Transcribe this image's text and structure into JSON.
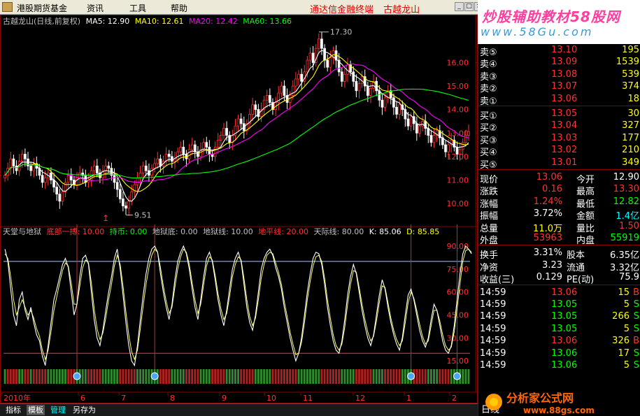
{
  "menu": {
    "items": [
      "港股期货基金",
      "资讯",
      "工具",
      "帮助"
    ],
    "center_title": "通达信金融终端",
    "stock_link": "古越龙山",
    "win_buttons": [
      "_",
      "□",
      "×"
    ]
  },
  "banner": {
    "title": "炒股辅助教材58股网",
    "url": "www.58Gu.com"
  },
  "main_chart": {
    "header": {
      "name": "古越龙山(日线,前复权)",
      "ma5": "MA5: 12.90",
      "ma10": "MA10: 12.61",
      "ma20": "MA20: 12.42",
      "ma60": "MA60: 13.66"
    },
    "high_label": "17.30",
    "low_label": "9.51",
    "y_ticks": [
      "16.00",
      "15.00",
      "14.00",
      "13.00",
      "12.00",
      "11.00",
      "10.00"
    ],
    "y_tick_values": [
      16,
      15,
      14,
      13,
      12,
      11,
      10
    ],
    "ylim": [
      9.2,
      17.5
    ],
    "colors": {
      "up": "#ff3232",
      "down": "#ffffff",
      "ma5": "#ffffff",
      "ma10": "#ffff00",
      "ma20": "#ff00ff",
      "ma60": "#00ff00"
    }
  },
  "indicator": {
    "header": {
      "name": "天堂与地狱",
      "bottom_buy": "底部一搏: 10.00",
      "hold": "持币: 0.00",
      "hell_bottom": "地狱底: 0.00",
      "hell_line": "地狱线: 10.00",
      "flat_line": "地平线: 20.00",
      "sky_line": "天际线: 80.00",
      "k": "K: 85.06",
      "d": "D: 85.85"
    },
    "y_ticks": [
      "90.00",
      "75.00",
      "60.00",
      "45.00",
      "30.00",
      "15.00"
    ],
    "y_tick_values": [
      90,
      75,
      60,
      45,
      30,
      15
    ],
    "ylim": [
      0,
      95
    ],
    "sky": 80,
    "flat": 20
  },
  "x_axis": {
    "labels": [
      "2010年",
      "6",
      "7",
      "8",
      "9",
      "10",
      "11",
      "12",
      "1",
      "2"
    ]
  },
  "chart_data": {
    "type": "candlestick",
    "note_series": "price panel daily OHLC; indicator panel K and D lines",
    "candles_close": [
      11.2,
      11.5,
      11.9,
      11.6,
      11.4,
      11.8,
      12.1,
      11.9,
      11.6,
      11.4,
      11.7,
      11.5,
      11.2,
      10.9,
      11.1,
      11.3,
      11.0,
      10.7,
      10.4,
      10.1,
      10.5,
      10.9,
      11.2,
      11.0,
      10.8,
      11.1,
      11.3,
      11.2,
      10.9,
      11.0,
      11.4,
      11.6,
      11.3,
      11.1,
      11.4,
      11.6,
      11.5,
      11.2,
      10.9,
      10.6,
      10.2,
      9.9,
      9.8,
      10.1,
      10.5,
      10.8,
      11.1,
      11.3,
      11.6,
      11.4,
      11.2,
      11.5,
      11.7,
      11.9,
      11.6,
      11.8,
      12.1,
      12.0,
      11.8,
      11.9,
      12.2,
      12.4,
      12.1,
      11.9,
      12.3,
      12.5,
      12.2,
      12.0,
      12.3,
      12.6,
      12.4,
      12.1,
      12.0,
      12.4,
      12.7,
      12.9,
      13.2,
      12.9,
      12.6,
      12.9,
      13.3,
      13.6,
      13.4,
      13.1,
      13.4,
      13.8,
      14.2,
      14.0,
      13.7,
      14.0,
      14.4,
      14.6,
      14.3,
      14.0,
      14.3,
      14.7,
      15.0,
      14.6,
      14.3,
      14.6,
      15.0,
      15.3,
      15.5,
      15.2,
      15.6,
      16.1,
      16.4,
      16.0,
      16.6,
      17.0,
      16.6,
      16.1,
      15.8,
      16.2,
      16.5,
      16.1,
      15.6,
      15.2,
      15.5,
      15.9,
      15.6,
      15.2,
      14.8,
      15.1,
      15.4,
      15.0,
      14.6,
      14.9,
      15.2,
      14.8,
      14.4,
      14.1,
      14.5,
      14.8,
      14.5,
      14.1,
      13.8,
      14.2,
      14.0,
      13.6,
      13.3,
      13.7,
      13.4,
      13.0,
      13.3,
      13.5,
      13.2,
      12.9,
      12.6,
      12.9,
      13.1,
      12.8,
      12.5,
      12.2,
      12.5,
      12.7,
      12.4,
      12.1,
      12.3,
      12.6,
      12.9,
      13.06
    ],
    "k_values": [
      88,
      80,
      62,
      45,
      38,
      55,
      60,
      48,
      42,
      50,
      40,
      32,
      28,
      18,
      12,
      25,
      40,
      55,
      62,
      70,
      78,
      82,
      76,
      60,
      45,
      52,
      70,
      82,
      84,
      78,
      60,
      42,
      30,
      25,
      35,
      48,
      60,
      70,
      82,
      88,
      75,
      58,
      40,
      25,
      15,
      12,
      25,
      42,
      58,
      72,
      82,
      88,
      90,
      86,
      72,
      60,
      50,
      42,
      52,
      68,
      80,
      86,
      90,
      85,
      75,
      62,
      50,
      42,
      55,
      70,
      82,
      86,
      80,
      68,
      55,
      45,
      38,
      48,
      62,
      75,
      82,
      86,
      80,
      65,
      50,
      40,
      35,
      45,
      60,
      75,
      82,
      86,
      88,
      84,
      76,
      70,
      62,
      50,
      40,
      30,
      22,
      15,
      20,
      30,
      45,
      60,
      72,
      82,
      86,
      85,
      78,
      65,
      50,
      38,
      28,
      22,
      20,
      28,
      42,
      58,
      70,
      78,
      72,
      60,
      48,
      38,
      30,
      25,
      32,
      45,
      58,
      68,
      62,
      50,
      40,
      32,
      26,
      22,
      30,
      45,
      58,
      62,
      55,
      45,
      35,
      28,
      24,
      30,
      42,
      52,
      48,
      38,
      28,
      22,
      20,
      25,
      38,
      55,
      72,
      85,
      90,
      88,
      85.06
    ],
    "d_values": [
      85,
      82,
      70,
      55,
      45,
      50,
      55,
      50,
      45,
      48,
      43,
      36,
      31,
      22,
      16,
      22,
      34,
      48,
      57,
      66,
      74,
      79,
      77,
      66,
      52,
      52,
      64,
      76,
      81,
      79,
      66,
      49,
      36,
      29,
      33,
      43,
      55,
      65,
      77,
      84,
      78,
      64,
      47,
      32,
      21,
      16,
      22,
      36,
      51,
      65,
      76,
      84,
      88,
      86,
      76,
      64,
      54,
      46,
      50,
      63,
      75,
      83,
      88,
      86,
      78,
      66,
      55,
      46,
      52,
      65,
      77,
      83,
      81,
      71,
      59,
      49,
      42,
      46,
      57,
      70,
      78,
      83,
      81,
      69,
      55,
      44,
      38,
      43,
      55,
      69,
      78,
      84,
      86,
      85,
      79,
      73,
      65,
      54,
      44,
      34,
      26,
      19,
      20,
      27,
      40,
      55,
      67,
      77,
      83,
      84,
      80,
      69,
      55,
      43,
      32,
      25,
      22,
      26,
      37,
      52,
      65,
      74,
      73,
      63,
      52,
      42,
      34,
      28,
      31,
      41,
      53,
      64,
      63,
      53,
      43,
      35,
      29,
      25,
      28,
      40,
      53,
      60,
      56,
      48,
      39,
      31,
      26,
      28,
      38,
      48,
      48,
      41,
      32,
      25,
      22,
      24,
      34,
      49,
      65,
      80,
      87,
      88,
      85.85
    ],
    "buy_marker_indices": [
      25,
      52,
      141,
      157,
      171,
      183
    ]
  },
  "quotes": {
    "asks": [
      {
        "label": "卖⑤",
        "price": "13.10",
        "vol": "195"
      },
      {
        "label": "卖④",
        "price": "13.09",
        "vol": "1539"
      },
      {
        "label": "卖③",
        "price": "13.08",
        "vol": "539"
      },
      {
        "label": "卖②",
        "price": "13.07",
        "vol": "374"
      },
      {
        "label": "卖①",
        "price": "13.06",
        "vol": "18"
      }
    ],
    "bids": [
      {
        "label": "买①",
        "price": "13.05",
        "vol": "30"
      },
      {
        "label": "买②",
        "price": "13.04",
        "vol": "327"
      },
      {
        "label": "买③",
        "price": "13.03",
        "vol": "177"
      },
      {
        "label": "买④",
        "price": "13.02",
        "vol": "210"
      },
      {
        "label": "买⑤",
        "price": "13.01",
        "vol": "349"
      }
    ],
    "stats": [
      {
        "l1": "现价",
        "v1": "13.06",
        "c1": "#ff3232",
        "l2": "今开",
        "v2": "12.90",
        "c2": "#ffffff"
      },
      {
        "l1": "涨跌",
        "v1": "0.16",
        "c1": "#ff3232",
        "l2": "最高",
        "v2": "13.30",
        "c2": "#ff3232"
      },
      {
        "l1": "涨幅",
        "v1": "1.24%",
        "c1": "#ff3232",
        "l2": "最低",
        "v2": "12.82",
        "c2": "#00ff00"
      },
      {
        "l1": "振幅",
        "v1": "3.72%",
        "c1": "#ffffff",
        "l2": "金额",
        "v2": "1.4亿",
        "c2": "#00ffff"
      },
      {
        "l1": "总量",
        "v1": "11.0万",
        "c1": "#ffff00",
        "l2": "量比",
        "v2": "1.50",
        "c2": "#ff3232"
      },
      {
        "l1": "外盘",
        "v1": "53963",
        "c1": "#ff3232",
        "l2": "内盘",
        "v2": "55919",
        "c2": "#00ff00"
      }
    ],
    "fundamentals": [
      {
        "l1": "换手",
        "v1": "3.31%",
        "l2": "股本",
        "v2": "6.35亿"
      },
      {
        "l1": "净资",
        "v1": "3.23",
        "l2": "流通",
        "v2": "3.32亿"
      },
      {
        "l1": "收益(三)",
        "v1": "0.129",
        "l2": "PE(动)",
        "v2": "75.9"
      }
    ],
    "ticks": [
      {
        "time": "14:59",
        "price": "13.06",
        "vol": "15",
        "dir": "B",
        "color": "#ff3232"
      },
      {
        "time": "14:59",
        "price": "13.05",
        "vol": "5",
        "dir": "S",
        "color": "#00ff00"
      },
      {
        "time": "14:59",
        "price": "13.05",
        "vol": "266",
        "dir": "S",
        "color": "#00ff00"
      },
      {
        "time": "14:59",
        "price": "13.05",
        "vol": "5",
        "dir": "S",
        "color": "#00ff00"
      },
      {
        "time": "14:59",
        "price": "13.06",
        "vol": "326",
        "dir": "B",
        "color": "#ff3232"
      },
      {
        "time": "14:59",
        "price": "13.06",
        "vol": "17",
        "dir": "S",
        "color": "#00ff00"
      },
      {
        "time": "14:59",
        "price": "13.06",
        "vol": "5",
        "dir": "S",
        "color": "#00ff00"
      }
    ],
    "date_label": "日线"
  },
  "bottom_tabs": [
    "指标",
    "模板",
    "管理",
    "另存为"
  ],
  "watermark": {
    "text": "分析家公式网",
    "url": "www.88gs.com"
  }
}
